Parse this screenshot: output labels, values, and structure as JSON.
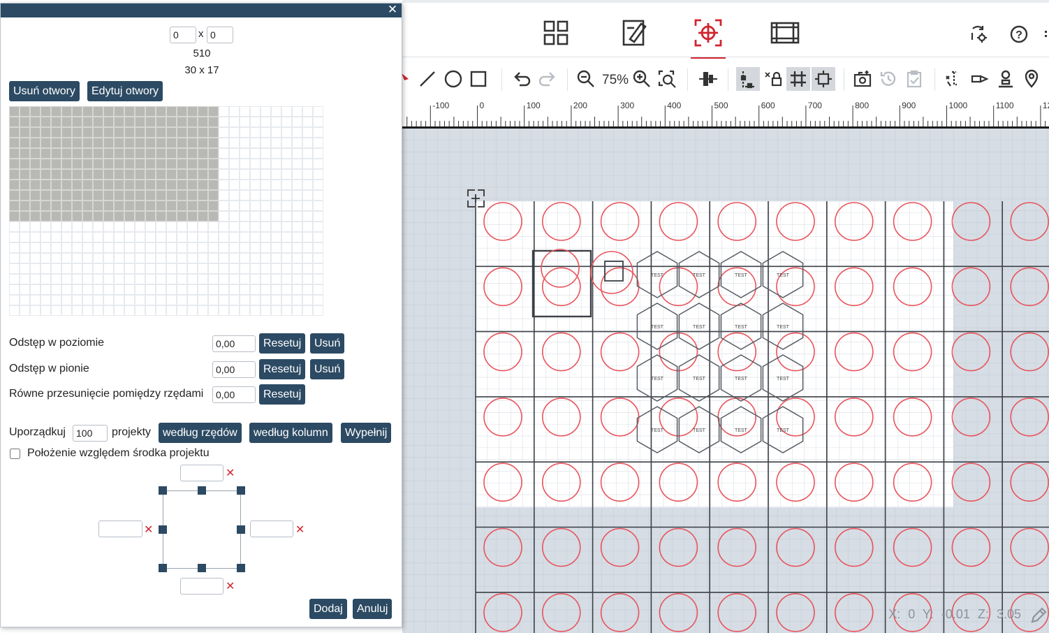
{
  "dialog": {
    "close_icon": "close-icon",
    "size_inputs": {
      "cols_value": "0",
      "rows_value": "0",
      "separator": "x"
    },
    "count_text": "510",
    "dims_text": "30 x 17",
    "buttons": {
      "remove_holes": "Usuń otwory",
      "edit_holes": "Edytuj otwory"
    },
    "grid": {
      "columns": 30,
      "rows": 20,
      "filled_columns": 20,
      "filled_rows": 11,
      "filled_color": "#b8b8b4",
      "empty_color": "#ffffff"
    },
    "spacing": {
      "horizontal": {
        "label": "Odstęp w poziomie",
        "value": "0,00",
        "reset": "Resetuj",
        "remove": "Usuń"
      },
      "vertical": {
        "label": "Odstęp w pionie",
        "value": "0,00",
        "reset": "Resetuj",
        "remove": "Usuń"
      },
      "row_offset": {
        "label": "Równe przesunięcie pomiędzy rzędami",
        "value": "0,00",
        "reset": "Resetuj"
      }
    },
    "arrange": {
      "prefix": "Uporządkuj",
      "count_value": "100",
      "suffix": "projekty",
      "by_rows": "według rzędów",
      "by_columns": "według kolumn",
      "fill": "Wypełnij"
    },
    "center_checkbox": {
      "label": "Położenie względem środka projektu",
      "checked": false
    },
    "margins": {
      "top": "",
      "left": "",
      "right": "",
      "bottom": ""
    },
    "footer": {
      "add": "Dodaj",
      "cancel": "Anuluj"
    }
  },
  "topbar": {
    "modes": [
      {
        "icon": "grid-layout-icon",
        "active": false
      },
      {
        "icon": "edit-design-icon",
        "active": false
      },
      {
        "icon": "target-crosshair-icon",
        "active": true
      },
      {
        "icon": "film-frame-icon",
        "active": false
      }
    ],
    "utilities": [
      "sync-settings-icon",
      "help-icon",
      "more-icon"
    ],
    "accent": "#d0252f"
  },
  "toolbar": {
    "zoom": "75%",
    "tools": [
      "pointer-icon",
      "line-icon",
      "circle-icon",
      "rectangle-icon",
      "undo-icon",
      "redo-icon",
      "zoom-out-icon",
      "zoom-in-icon",
      "zoom-fit-icon",
      "align-icon",
      "snap-icon",
      "lock-icon",
      "grid-toggle-icon",
      "center-icon",
      "camera-icon",
      "history-icon",
      "clipboard-check-icon",
      "trace-icon",
      "sensor-icon",
      "stamp-icon",
      "location-pin-icon"
    ]
  },
  "ruler": {
    "labels": [
      "-100",
      "0",
      "100",
      "200",
      "300",
      "400",
      "500",
      "600",
      "700",
      "800",
      "900",
      "1000",
      "1100",
      "12"
    ]
  },
  "workspace": {
    "hole_rows": 7,
    "hole_cols": 10,
    "hole_color": "#e8545c",
    "hex_label": "TEST",
    "coordinates": "X: 0  Y: -0.01  Z: 3.05"
  }
}
